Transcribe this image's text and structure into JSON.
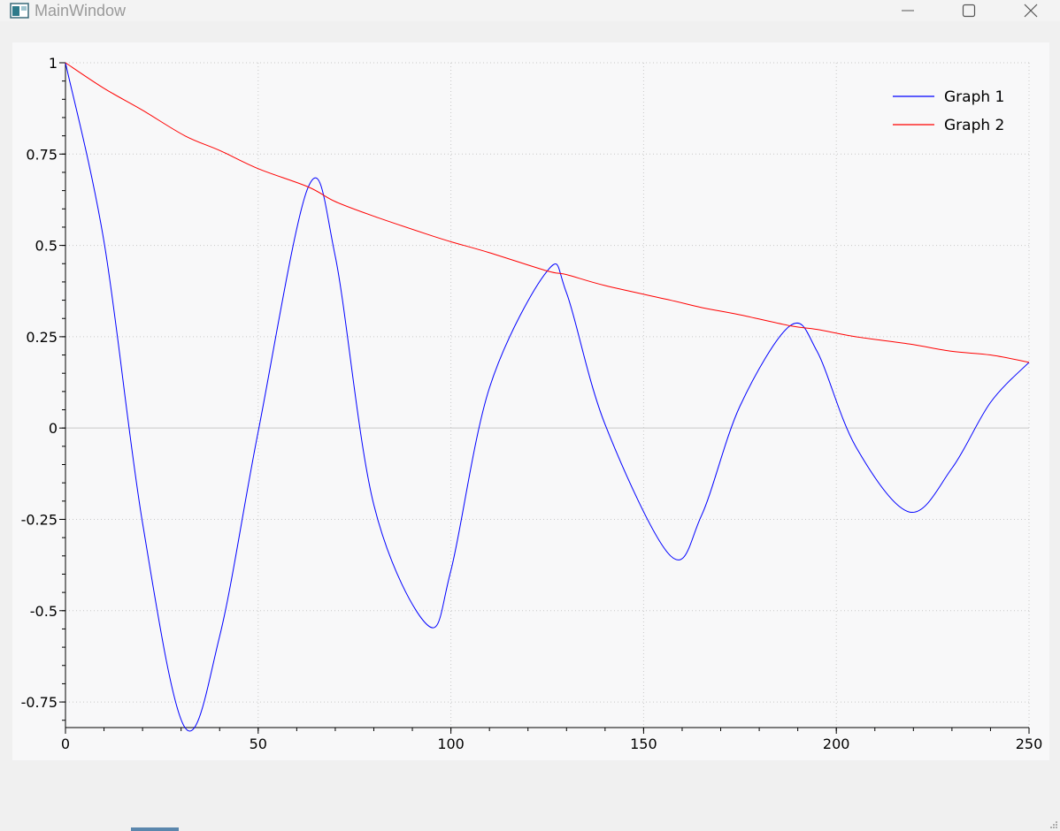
{
  "window": {
    "title": "MainWindow",
    "icons": {
      "app": "app-window-icon",
      "minimize": "minimize-icon",
      "maximize": "maximize-icon",
      "close": "close-icon"
    }
  },
  "chart_data": {
    "type": "line",
    "title": "",
    "xlabel": "",
    "ylabel": "",
    "xlim": [
      0,
      250
    ],
    "ylim": [
      -0.82,
      1
    ],
    "x_ticks": [
      0,
      50,
      100,
      150,
      200,
      250
    ],
    "x_tick_labels": [
      "0",
      "50",
      "100",
      "150",
      "200",
      "250"
    ],
    "y_ticks": [
      1,
      0.75,
      0.5,
      0.25,
      0,
      -0.25,
      -0.5,
      -0.75
    ],
    "y_tick_labels": [
      "1",
      "0.75",
      "0.5",
      "0.25",
      "0",
      "-0.25",
      "-0.5",
      "-0.75"
    ],
    "grid": true,
    "legend_position": "top-right",
    "x": [
      0,
      10,
      20,
      31,
      40,
      50,
      63,
      70,
      80,
      94,
      100,
      110,
      125,
      130,
      140,
      157,
      165,
      175,
      188,
      195,
      205,
      219,
      230,
      240,
      250
    ],
    "series": [
      {
        "name": "Graph 1",
        "color": "#0000ff",
        "values": [
          1.0,
          0.51,
          -0.26,
          -0.82,
          -0.57,
          -0.01,
          0.66,
          0.47,
          -0.21,
          -0.54,
          -0.39,
          0.11,
          0.43,
          0.37,
          0.01,
          -0.35,
          -0.24,
          0.06,
          0.28,
          0.21,
          -0.05,
          -0.23,
          -0.11,
          0.07,
          0.18
        ]
      },
      {
        "name": "Graph 2",
        "color": "#ff0000",
        "values": [
          1.0,
          0.93,
          0.87,
          0.8,
          0.76,
          0.71,
          0.66,
          0.62,
          0.58,
          0.53,
          0.51,
          0.48,
          0.43,
          0.42,
          0.39,
          0.35,
          0.33,
          0.31,
          0.28,
          0.27,
          0.25,
          0.23,
          0.21,
          0.2,
          0.18
        ]
      }
    ]
  }
}
